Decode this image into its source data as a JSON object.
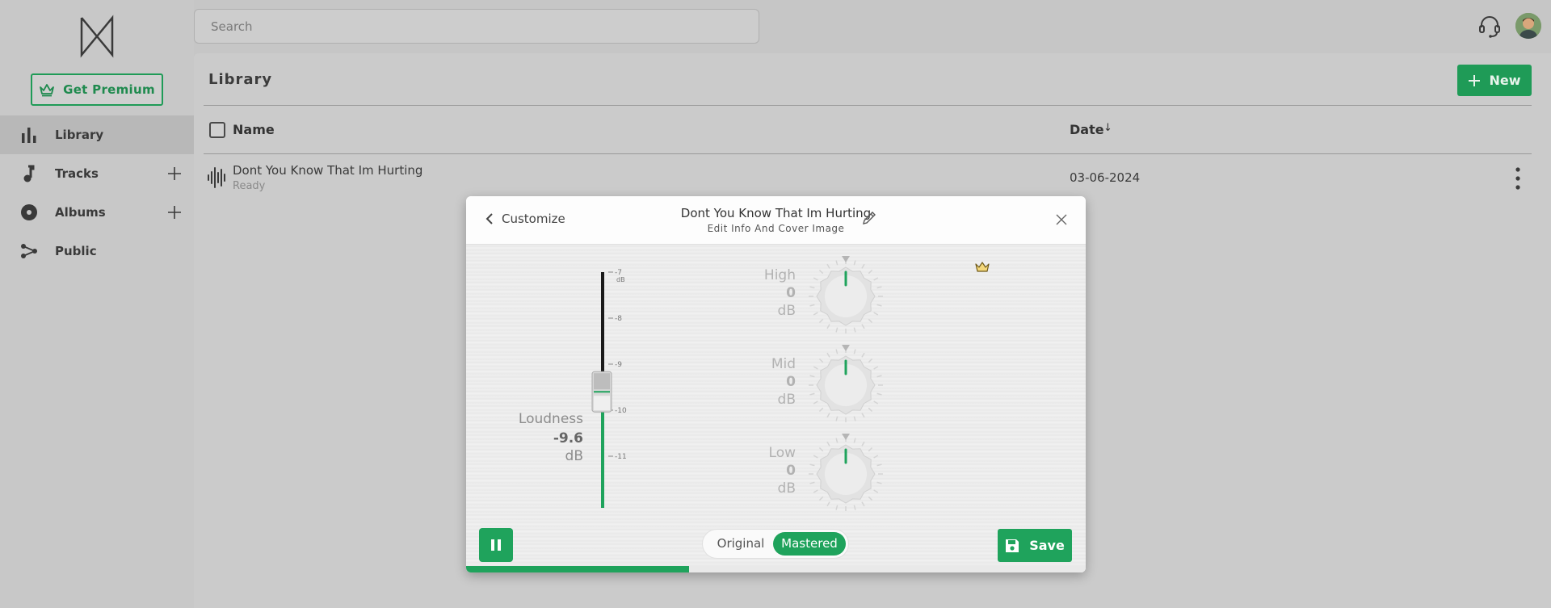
{
  "sidebar": {
    "premium_label": "Get Premium",
    "items": [
      {
        "label": "Library",
        "icon": "bar-chart-icon",
        "active": true
      },
      {
        "label": "Tracks",
        "icon": "music-note-icon",
        "plus": true
      },
      {
        "label": "Albums",
        "icon": "disc-icon",
        "plus": true
      },
      {
        "label": "Public",
        "icon": "share-icon"
      }
    ]
  },
  "topbar": {
    "search_placeholder": "Search"
  },
  "library": {
    "title": "Library",
    "new_label": "New",
    "columns": {
      "name": "Name",
      "date": "Date",
      "sort_indicator": "↓"
    },
    "rows": [
      {
        "title": "Dont You Know That Im Hurting",
        "status": "Ready",
        "date": "03-06-2024"
      }
    ]
  },
  "modal": {
    "back_label": "Customize",
    "track_title": "Dont You Know That Im Hurting",
    "subtitle": "Edit Info And Cover Image",
    "loudness": {
      "label": "Loudness",
      "value": "-9.6",
      "unit": "dB",
      "value_number": -9.6,
      "scale_ticks": [
        "-7",
        "-8",
        "-9",
        "-10",
        "-11"
      ],
      "scale_unit": "dB"
    },
    "eq": [
      {
        "label": "High",
        "value": "0",
        "unit": "dB"
      },
      {
        "label": "Mid",
        "value": "0",
        "unit": "dB"
      },
      {
        "label": "Low",
        "value": "0",
        "unit": "dB"
      }
    ],
    "toggle": {
      "original": "Original",
      "mastered": "Mastered",
      "selected": "Mastered"
    },
    "save_label": "Save",
    "playback_progress": 0.36
  },
  "colors": {
    "accent": "#1fa35c",
    "background": "#c6c6c6",
    "modal_bg": "#f4f4f4"
  }
}
